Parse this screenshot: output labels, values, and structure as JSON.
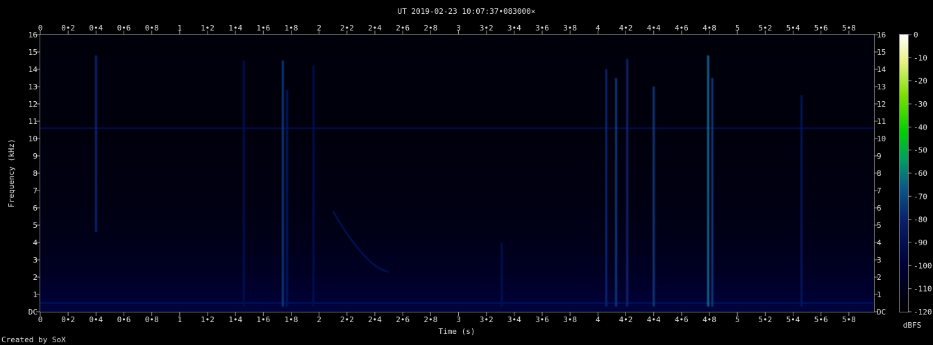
{
  "chart_data": {
    "type": "heatmap",
    "title": "UT 2019-02-23 10:07:37•083000×",
    "xlabel": "Time (s)",
    "ylabel": "Frequency (kHz)",
    "xlim": [
      0,
      5.98
    ],
    "ylim": [
      0,
      16
    ],
    "x_ticks": [
      "0",
      "0•2",
      "0•4",
      "0•6",
      "0•8",
      "1",
      "1•2",
      "1•4",
      "1•6",
      "1•8",
      "2",
      "2•2",
      "2•4",
      "2•6",
      "2•8",
      "3",
      "3•2",
      "3•4",
      "3•6",
      "3•8",
      "4",
      "4•2",
      "4•4",
      "4•6",
      "4•8",
      "5",
      "5•2",
      "5•4",
      "5•6",
      "5•8"
    ],
    "y_ticks": [
      "DC",
      "1",
      "2",
      "3",
      "4",
      "5",
      "6",
      "7",
      "8",
      "9",
      "10",
      "11",
      "12",
      "13",
      "14",
      "15",
      "16"
    ],
    "colorbar": {
      "label": "dBFS",
      "range": [
        -120,
        0
      ],
      "ticks": [
        "0",
        "-10",
        "-20",
        "-30",
        "-40",
        "-50",
        "-60",
        "-70",
        "-80",
        "-90",
        "-100",
        "-110",
        "-120"
      ]
    },
    "features": [
      {
        "kind": "tone",
        "freq_khz": 10.6,
        "level_dbfs": -90
      },
      {
        "kind": "tone",
        "freq_khz": 0.5,
        "level_dbfs": -85
      },
      {
        "kind": "impulse",
        "t": 0.4,
        "f_min": 4.6,
        "f_max": 14.8,
        "level_dbfs": -80
      },
      {
        "kind": "impulse",
        "t": 1.46,
        "f_min": 0.3,
        "f_max": 14.5,
        "level_dbfs": -90
      },
      {
        "kind": "impulse",
        "t": 1.74,
        "f_min": 0.3,
        "f_max": 14.5,
        "level_dbfs": -75
      },
      {
        "kind": "impulse",
        "t": 1.77,
        "f_min": 0.3,
        "f_max": 12.8,
        "level_dbfs": -85
      },
      {
        "kind": "impulse",
        "t": 1.96,
        "f_min": 0.3,
        "f_max": 14.2,
        "level_dbfs": -90
      },
      {
        "kind": "impulse",
        "t": 3.31,
        "f_min": 0.3,
        "f_max": 4.0,
        "level_dbfs": -90
      },
      {
        "kind": "impulse",
        "t": 4.06,
        "f_min": 0.3,
        "f_max": 14.0,
        "level_dbfs": -80
      },
      {
        "kind": "impulse",
        "t": 4.13,
        "f_min": 0.3,
        "f_max": 13.5,
        "level_dbfs": -75
      },
      {
        "kind": "impulse",
        "t": 4.21,
        "f_min": 0.3,
        "f_max": 14.6,
        "level_dbfs": -80
      },
      {
        "kind": "impulse",
        "t": 4.4,
        "f_min": 0.3,
        "f_max": 13.0,
        "level_dbfs": -75
      },
      {
        "kind": "impulse",
        "t": 4.79,
        "f_min": 0.3,
        "f_max": 14.8,
        "level_dbfs": -65
      },
      {
        "kind": "impulse",
        "t": 4.82,
        "f_min": 0.3,
        "f_max": 13.5,
        "level_dbfs": -75
      },
      {
        "kind": "impulse",
        "t": 5.46,
        "f_min": 0.3,
        "f_max": 12.5,
        "level_dbfs": -85
      },
      {
        "kind": "sweep",
        "t_start": 2.1,
        "t_end": 2.5,
        "f_start": 5.8,
        "f_end": 2.3,
        "level_dbfs": -85
      }
    ]
  },
  "footer": {
    "credit": "Created by SoX"
  }
}
